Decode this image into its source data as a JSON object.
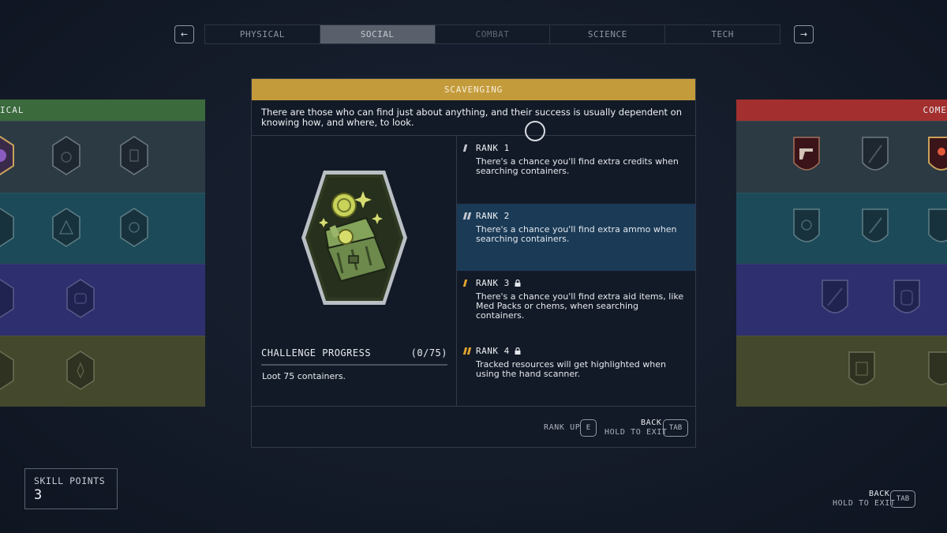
{
  "nav": {
    "prev_icon": "←",
    "next_icon": "→",
    "tabs": [
      {
        "label": "PHYSICAL"
      },
      {
        "label": "SOCIAL"
      },
      {
        "label": "COMBAT"
      },
      {
        "label": "SCIENCE"
      },
      {
        "label": "TECH"
      }
    ],
    "active_tab": "SOCIAL"
  },
  "left_panel": {
    "header": "ICAL",
    "header_color": "#3b6a3c"
  },
  "right_panel": {
    "header": "COME",
    "header_color": "#a3302e"
  },
  "perk": {
    "title": "SCAVENGING",
    "description": "There are those who can find just about anything, and their success is usually dependent on knowing how, and where, to look.",
    "icon": "treasure-chest-icon",
    "challenge": {
      "label": "CHALLENGE PROGRESS",
      "count": "(0/75)",
      "progress": 0,
      "description": "Loot 75 containers."
    },
    "ranks": [
      {
        "title": "RANK 1",
        "description": "There's a chance you'll find extra credits when searching containers.",
        "locked": false,
        "selected": false
      },
      {
        "title": "RANK 2",
        "description": "There's a chance you'll find extra ammo when searching containers.",
        "locked": false,
        "selected": true
      },
      {
        "title": "RANK 3",
        "description": "There's a chance you'll find extra aid items, like Med Packs or chems, when searching containers.",
        "locked": true,
        "selected": false
      },
      {
        "title": "RANK 4",
        "description": "Tracked resources will get highlighted when using the hand scanner.",
        "locked": true,
        "selected": false
      }
    ]
  },
  "footer": {
    "rank_up_label": "RANK UP",
    "rank_up_key": "E",
    "back_label": "BACK",
    "hold_label": "HOLD TO EXIT",
    "back_key": "TAB"
  },
  "screen_footer": {
    "back_label": "BACK",
    "hold_label": "HOLD TO EXIT",
    "back_key": "TAB"
  },
  "skill_points": {
    "label": "SKILL POINTS",
    "value": "3"
  },
  "colors": {
    "header_gold": "#c49b3b",
    "selected_rank": "#1a3a56",
    "social_row_1": "#2c3a44",
    "social_row_2": "#1d4a58",
    "social_row_3": "#2e2f6e",
    "social_row_4": "#44482c"
  }
}
